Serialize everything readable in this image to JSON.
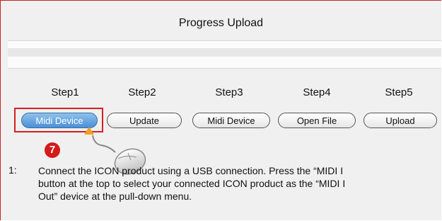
{
  "window": {
    "title": "Progress Upload"
  },
  "progress": {
    "value": 0
  },
  "steps": [
    {
      "label": "Step1",
      "button": "Midi Device"
    },
    {
      "label": "Step2",
      "button": "Update"
    },
    {
      "label": "Step3",
      "button": "Midi Device"
    },
    {
      "label": "Step4",
      "button": "Open File"
    },
    {
      "label": "Step5",
      "button": "Upload"
    }
  ],
  "callout": {
    "number": "7",
    "icon": "mouse-click-icon"
  },
  "instruction": {
    "number": "1:",
    "lines": [
      "Connect the ICON product using a USB connection. Press the “MIDI I",
      "button at the top to select your connected ICON product as the “MIDI I",
      "Out” device at the pull-down menu."
    ]
  },
  "colors": {
    "highlight": "#d42020",
    "active_button": "#4b8fd6",
    "badge": "#d41a1a"
  }
}
